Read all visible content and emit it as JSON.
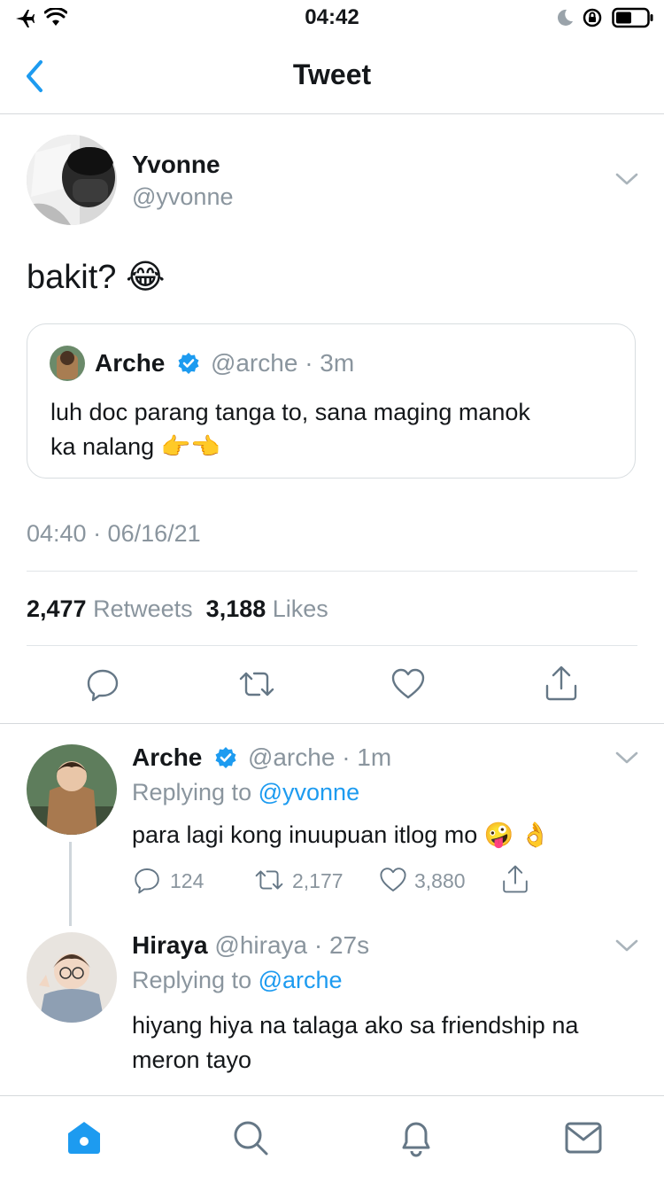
{
  "status_bar": {
    "time": "04:42"
  },
  "nav": {
    "title": "Tweet"
  },
  "main_tweet": {
    "author_name": "Yvonne",
    "author_handle": "@yvonne",
    "text": "bakit? 😂",
    "timestamp": "04:40 · 06/16/21",
    "retweets_count": "2,477",
    "retweets_label": "Retweets",
    "likes_count": "3,188",
    "likes_label": "Likes"
  },
  "quoted_tweet": {
    "author_name": "Arche",
    "author_handle": "@arche",
    "time": "· 3m",
    "text_line1": "luh doc parang tanga to, sana maging manok",
    "text_line2": "ka nalang 👉👈"
  },
  "replies": [
    {
      "author_name": "Arche",
      "author_handle": "@arche",
      "time": "· 1m",
      "replying_prefix": "Replying to",
      "replying_to": "@yvonne",
      "text": "para lagi kong inuupuan itlog mo 🤪 👌",
      "reply_count": "124",
      "retweet_count": "2,177",
      "like_count": "3,880"
    },
    {
      "author_name": "Hiraya",
      "author_handle": "@hiraya",
      "time": "· 27s",
      "replying_prefix": "Replying to",
      "replying_to": "@arche",
      "text_line1": "hiyang hiya na talaga ako sa friendship na",
      "text_line2": "meron tayo"
    }
  ],
  "colors": {
    "accent": "#1d9bf0",
    "muted": "#8a959e",
    "verified": "#1d9bf0"
  }
}
